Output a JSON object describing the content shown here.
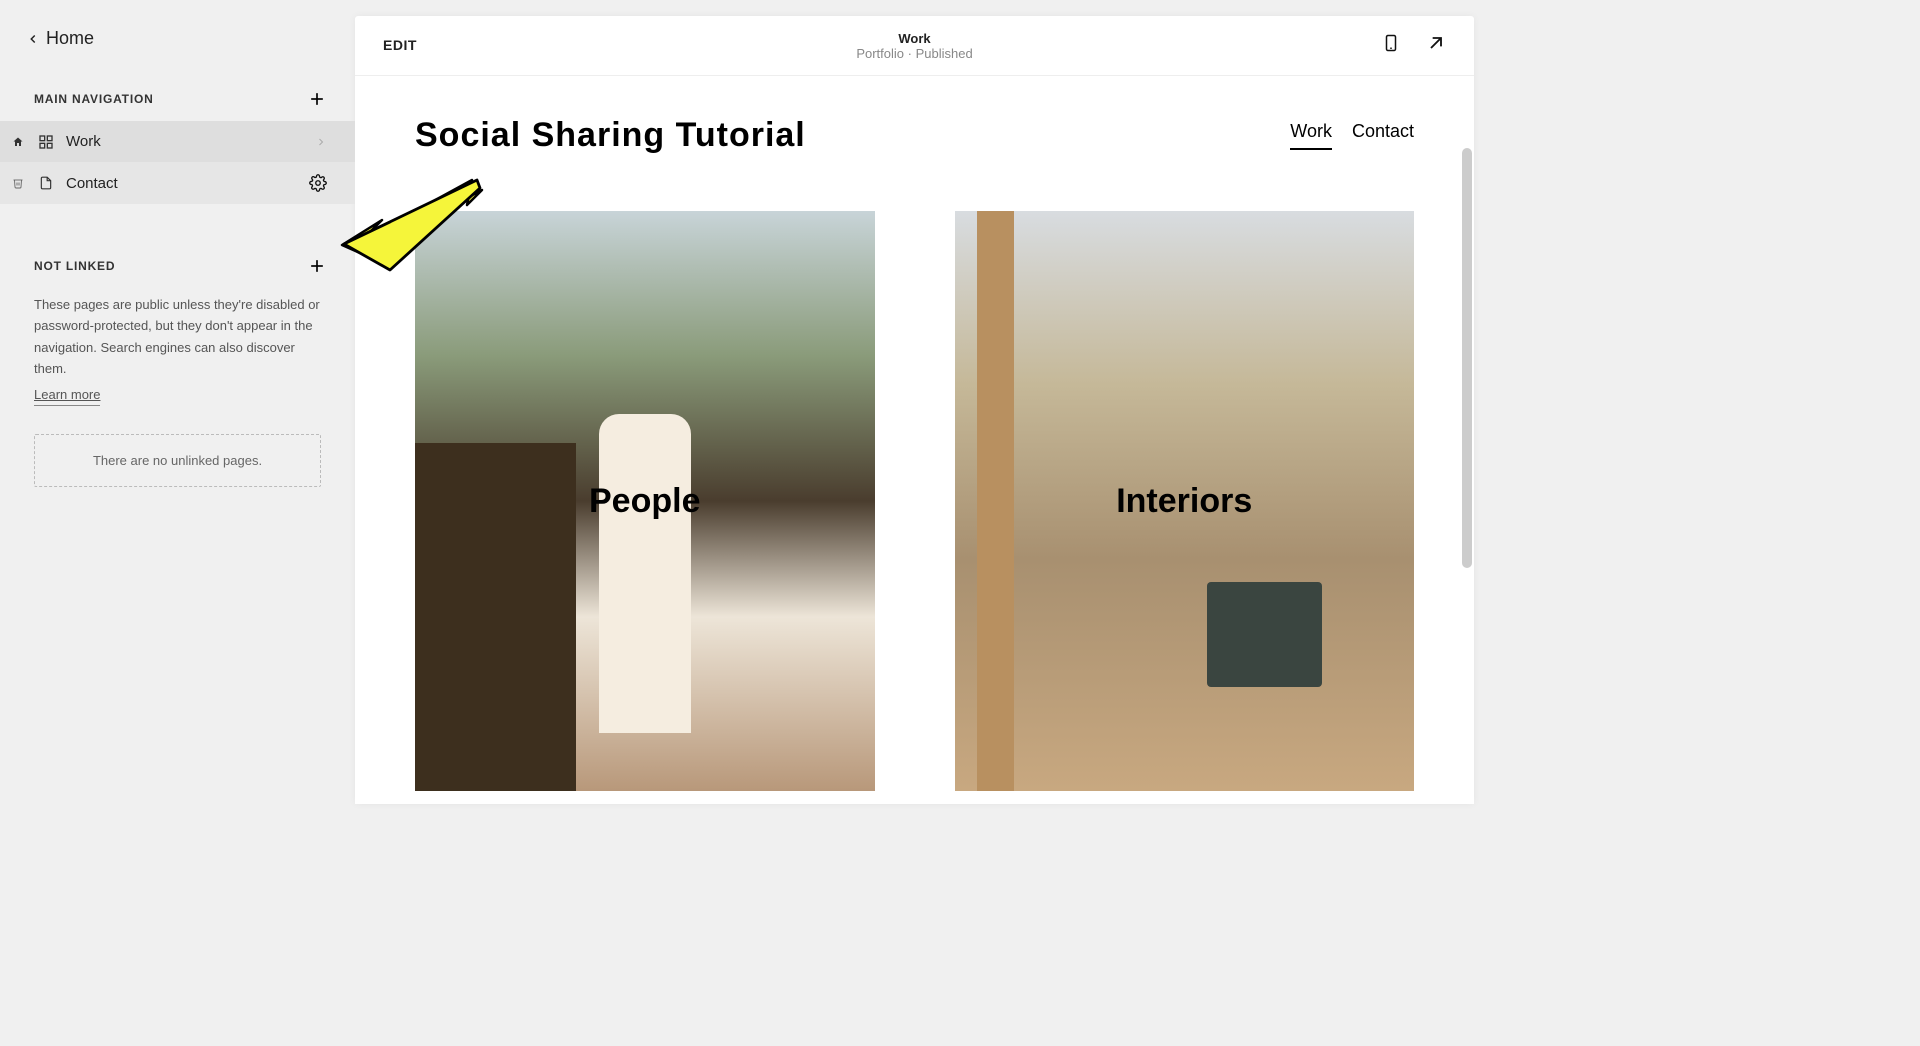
{
  "sidebar": {
    "home_label": "Home",
    "sections": {
      "main_nav": {
        "title": "MAIN NAVIGATION",
        "items": [
          {
            "label": "Work"
          },
          {
            "label": "Contact"
          }
        ]
      },
      "not_linked": {
        "title": "NOT LINKED",
        "description": "These pages are public unless they're disabled or password-protected, but they don't appear in the navigation. Search engines can also discover them.",
        "learn_more": "Learn more",
        "empty_text": "There are no unlinked pages."
      }
    }
  },
  "topbar": {
    "edit_label": "EDIT",
    "page_name": "Work",
    "page_meta": "Portfolio · Published"
  },
  "site": {
    "title": "Social Sharing Tutorial",
    "nav": [
      {
        "label": "Work",
        "active": true
      },
      {
        "label": "Contact",
        "active": false
      }
    ],
    "gallery": [
      {
        "label": "People"
      },
      {
        "label": "Interiors"
      }
    ]
  }
}
